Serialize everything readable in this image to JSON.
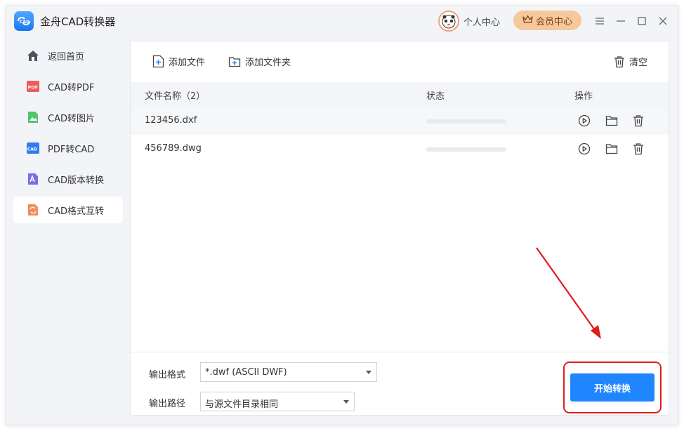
{
  "app": {
    "title": "金舟CAD转换器"
  },
  "header": {
    "user_center": "个人中心",
    "vip_center": "会员中心"
  },
  "sidebar": {
    "items": [
      {
        "label": "返回首页",
        "icon": "home-icon"
      },
      {
        "label": "CAD转PDF",
        "icon": "pdf-icon",
        "badge": "PDF"
      },
      {
        "label": "CAD转图片",
        "icon": "image-icon"
      },
      {
        "label": "PDF转CAD",
        "icon": "cad-file-icon",
        "badge": "CAD"
      },
      {
        "label": "CAD版本转换",
        "icon": "version-icon"
      },
      {
        "label": "CAD格式互转",
        "icon": "format-swap-icon",
        "active": true
      }
    ]
  },
  "toolbar": {
    "add_file": "添加文件",
    "add_folder": "添加文件夹",
    "clear": "清空"
  },
  "table": {
    "headers": {
      "name": "文件名称（2）",
      "status": "状态",
      "actions": "操作"
    },
    "rows": [
      {
        "name": "123456.dxf",
        "progress": 0
      },
      {
        "name": "456789.dwg",
        "progress": 0
      }
    ]
  },
  "output": {
    "format_label": "输出格式",
    "format_value": "*.dwf (ASCII DWF)",
    "path_label": "输出路径",
    "path_value": "与源文件目录相同"
  },
  "start_button": "开始转换",
  "colors": {
    "accent": "#1f86ff",
    "vip_bg": "#f5c99b",
    "highlight": "#e21b1b"
  }
}
